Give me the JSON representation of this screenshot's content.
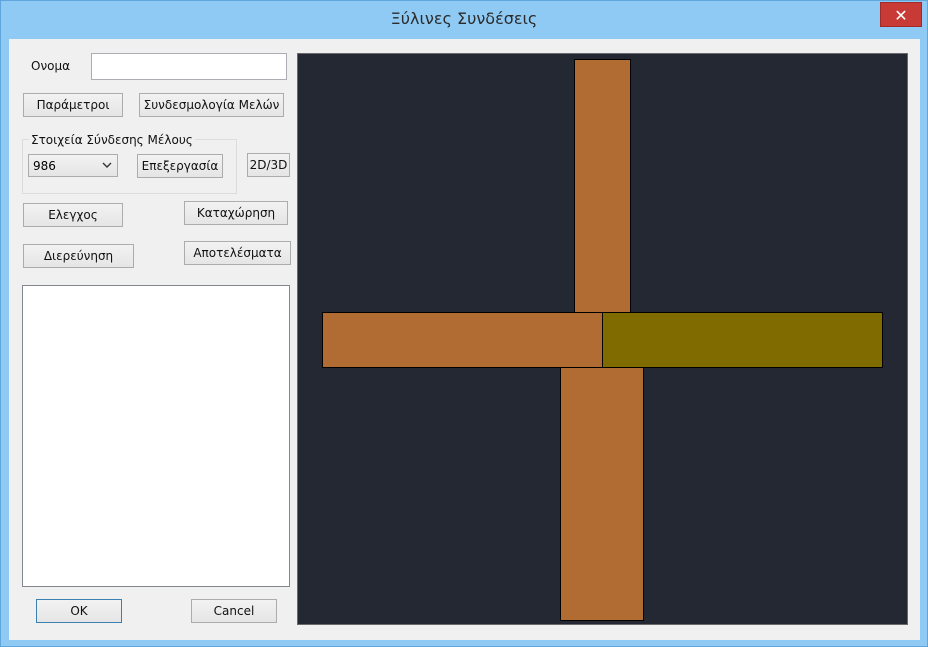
{
  "window": {
    "title": "Ξύλινες Συνδέσεις",
    "close_glyph": "✕"
  },
  "form": {
    "name_label": "Ονομα",
    "name_value": "",
    "parameters_button": "Παράμετροι",
    "member_connectivity_button": "Συνδεσμολογία Μελών",
    "group_title": "Στοιχεία Σύνδεσης Μέλους",
    "member_select_value": "986",
    "edit_button": "Επεξεργασία",
    "toggle_2d3d_button": "2D/3D",
    "check_button": "Ελεγχος",
    "register_button": "Καταχώρηση",
    "investigation_button": "Διερεύνηση",
    "results_button": "Αποτελέσματα",
    "results_list": [],
    "ok_button": "OK",
    "cancel_button": "Cancel"
  },
  "drawing": {
    "background_color": "#232833",
    "members": [
      {
        "name": "vertical-member-top",
        "color": "#b06c33"
      },
      {
        "name": "horizontal-member-left",
        "color": "#b06c33"
      },
      {
        "name": "horizontal-member-right",
        "color": "#7f6b00"
      },
      {
        "name": "vertical-member-bottom",
        "color": "#b06c33"
      }
    ]
  },
  "colors": {
    "title_bar": "#8fcaf5",
    "close_button": "#c73a36"
  }
}
